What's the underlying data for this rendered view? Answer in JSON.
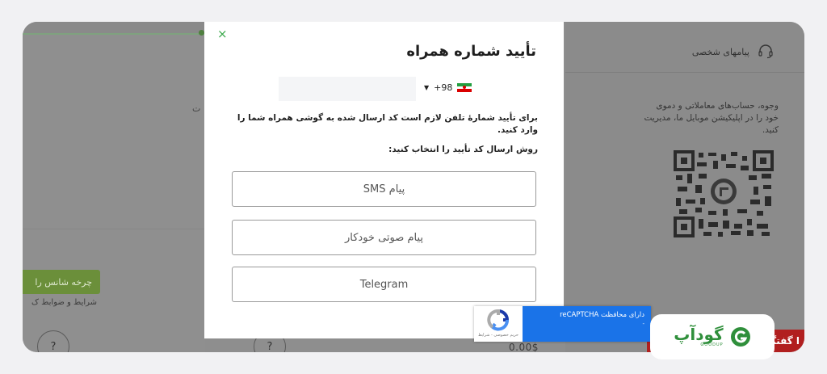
{
  "background_page": {
    "wheel_button": "چرخه شانس را ",
    "terms_link": "شرایط و ضوابط ک",
    "help_mark": "?",
    "left_fragment": "ت",
    "price": "0.00$",
    "right_header": "پیامهای شخصی",
    "right_description": "وجوه، حساب‌های معاملاتی و دموی خود را در اپلیکیشن موبایل ما، مدیریت کنید.",
    "chat_label": "ا گفتگ"
  },
  "modal": {
    "close": "×",
    "title": "تأیید شماره همراه",
    "country_code": "+98",
    "description": "برای تأیید شمارهٔ تلفن لازم است کد ارسال شده به گوشی همراه شما را وارد کنید.",
    "method_label": "روش ارسال کد تأیید را انتخاب کنید:",
    "options": [
      "پیام SMS",
      "پیام صوتی خودکار",
      "Telegram"
    ]
  },
  "recaptcha": {
    "line1": "دارای محافظت reCAPTCHA",
    "line2": "-",
    "links": "حریم خصوصی - شرایط"
  },
  "brand": {
    "name": "گودآپ",
    "sub": "GOODUP"
  },
  "colors": {
    "accent": "#3aa84a",
    "recaptcha_blue": "#1a73e8",
    "chat_red": "#b11f1f"
  }
}
